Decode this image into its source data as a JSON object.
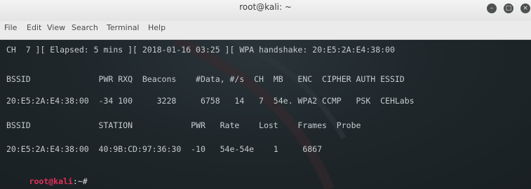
{
  "window": {
    "title": "root@kali: ~",
    "buttons": {
      "minimize": "–",
      "maximize": "□",
      "close": "×"
    }
  },
  "menu": {
    "items": [
      "File",
      "Edit",
      "View",
      "Search",
      "Terminal",
      "Help"
    ]
  },
  "terminal": {
    "lines": [
      "CH  7 ][ Elapsed: 5 mins ][ 2018-01-16 03:25 ][ WPA handshake: 20:E5:2A:E4:38:00",
      "BSSID              PWR RXQ  Beacons    #Data, #/s  CH  MB   ENC  CIPHER AUTH ESSID",
      "20:E5:2A:E4:38:00  -34 100     3228     6758   14   7  54e. WPA2 CCMP   PSK  CEHLabs",
      "BSSID              STATION            PWR   Rate    Lost    Frames  Probe",
      "20:E5:2A:E4:38:00  40:9B:CD:97:36:30  -10   54e-54e    1     6867"
    ],
    "prompt_user": "root@kali",
    "prompt_rest": ":~#"
  },
  "colors": {
    "terminal_bg": "#1d2428",
    "terminal_fg": "#c6ccce",
    "prompt_red": "#e0305a",
    "titlebar": "#ebebeb"
  }
}
